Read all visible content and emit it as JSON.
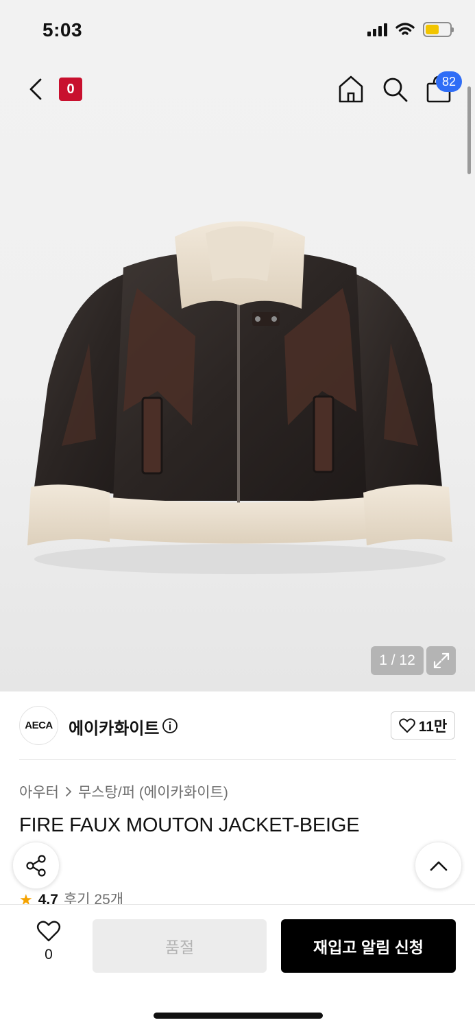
{
  "status_bar": {
    "time": "5:03",
    "icons": [
      "signal-icon",
      "wifi-icon",
      "battery-icon"
    ],
    "battery_color": "#f2c500"
  },
  "nav": {
    "brand_badge": "0",
    "bag_count": "82",
    "icons": [
      "back-icon",
      "home-icon",
      "search-icon",
      "bag-icon"
    ],
    "badge_color": "#2f6df6",
    "brand_badge_color": "#c8102e"
  },
  "gallery": {
    "counter": "1 / 12",
    "expand_icon": "expand-icon"
  },
  "brand": {
    "logo_text": "AECA",
    "name": "에이카화이트",
    "likes": "11만"
  },
  "breadcrumb": {
    "category": "아우터",
    "subcategory": "무스탕/퍼 (에이카화이트)"
  },
  "product": {
    "title": "FIRE FAUX MOUTON JACKET-BEIGE",
    "rating": "4.7",
    "reviews": "후기 25개"
  },
  "bottom_bar": {
    "wish_count": "0",
    "soldout_label": "품절",
    "restock_label": "재입고 알림 신청"
  }
}
